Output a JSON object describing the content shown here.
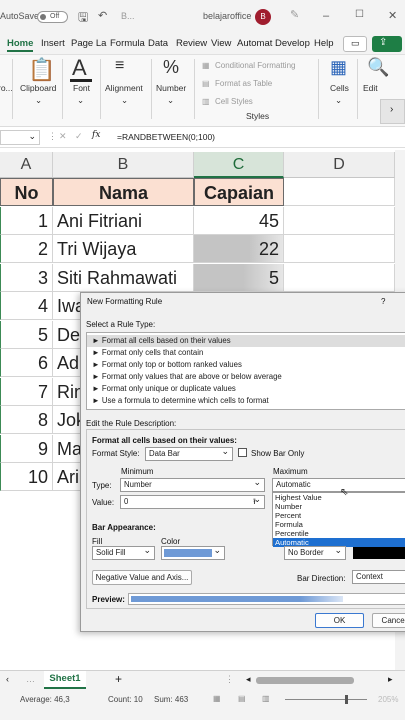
{
  "titlebar": {
    "autosave": "AutoSave",
    "toggle": "Off",
    "filename": "belajaroffice",
    "avatar": "B",
    "extra": "B..."
  },
  "menu": {
    "items": [
      "Home",
      "Insert",
      "Page La",
      "Formula",
      "Data",
      "Review",
      "View",
      "Automat",
      "Develop",
      "Help"
    ]
  },
  "ribbon": {
    "clipboard": "Clipboard",
    "font": "Font",
    "alignment": "Alignment",
    "number": "Number",
    "cond": "Conditional Formatting",
    "table": "Format as Table",
    "styles_btn": "Cell Styles",
    "styles": "Styles",
    "cells": "Cells",
    "edit": "Edit",
    "pct": "%",
    "cutoff": "ro..."
  },
  "formula": {
    "fx": "fx",
    "value": "=RANDBETWEEN(0;100)"
  },
  "columns": [
    "A",
    "B",
    "C",
    "D"
  ],
  "table": {
    "header": [
      "No",
      "Nama",
      "Capaian"
    ],
    "rows": [
      {
        "no": "1",
        "nama": "Ani Fitriani",
        "cap": "45"
      },
      {
        "no": "2",
        "nama": "Tri Wijaya",
        "cap": "22"
      },
      {
        "no": "3",
        "nama": "Siti Rahmawati",
        "cap": "5"
      },
      {
        "no": "4",
        "nama": "Iwa",
        "cap": ""
      },
      {
        "no": "5",
        "nama": "Dev",
        "cap": ""
      },
      {
        "no": "6",
        "nama": "Ad",
        "cap": ""
      },
      {
        "no": "7",
        "nama": "Rin",
        "cap": ""
      },
      {
        "no": "8",
        "nama": "Jok",
        "cap": ""
      },
      {
        "no": "9",
        "nama": "Ma",
        "cap": ""
      },
      {
        "no": "10",
        "nama": "Ari",
        "cap": ""
      }
    ],
    "bar_fraction": [
      0.45,
      0.22,
      0.05
    ]
  },
  "dialog": {
    "title": "New Formatting Rule",
    "help": "?",
    "select_type": "Select a Rule Type:",
    "rules": [
      "► Format all cells based on their values",
      "► Format only cells that contain",
      "► Format only top or bottom ranked values",
      "► Format only values that are above or below average",
      "► Format only unique or duplicate values",
      "► Use a formula to determine which cells to format"
    ],
    "edit_desc": "Edit the Rule Description:",
    "format_all": "Format all cells based on their values:",
    "format_style": "Format Style:",
    "format_style_value": "Data Bar",
    "show_bar_only": "Show Bar Only",
    "minimum": "Minimum",
    "maximum": "Maximum",
    "type": "Type:",
    "min_type": "Number",
    "max_type": "Automatic",
    "value": "Value:",
    "min_value": "0",
    "max_options": [
      "Highest Value",
      "Number",
      "Percent",
      "Formula",
      "Percentile",
      "Automatic"
    ],
    "bar_appearance": "Bar Appearance:",
    "fill": "Fill",
    "fill_value": "Solid Fill",
    "color": "Color",
    "border_value": "No Border",
    "neg_button": "Negative Value and Axis...",
    "bar_direction": "Bar Direction:",
    "bar_direction_value": "Context",
    "preview": "Preview:",
    "ok": "OK",
    "cancel": "Cancel",
    "bar_color": "#6f9ad6"
  },
  "sheet": {
    "tab": "Sheet1",
    "add": "+"
  },
  "status": {
    "average": "Average: 46,3",
    "count": "Count: 10",
    "sum": "Sum: 463",
    "zoom": "205%"
  }
}
